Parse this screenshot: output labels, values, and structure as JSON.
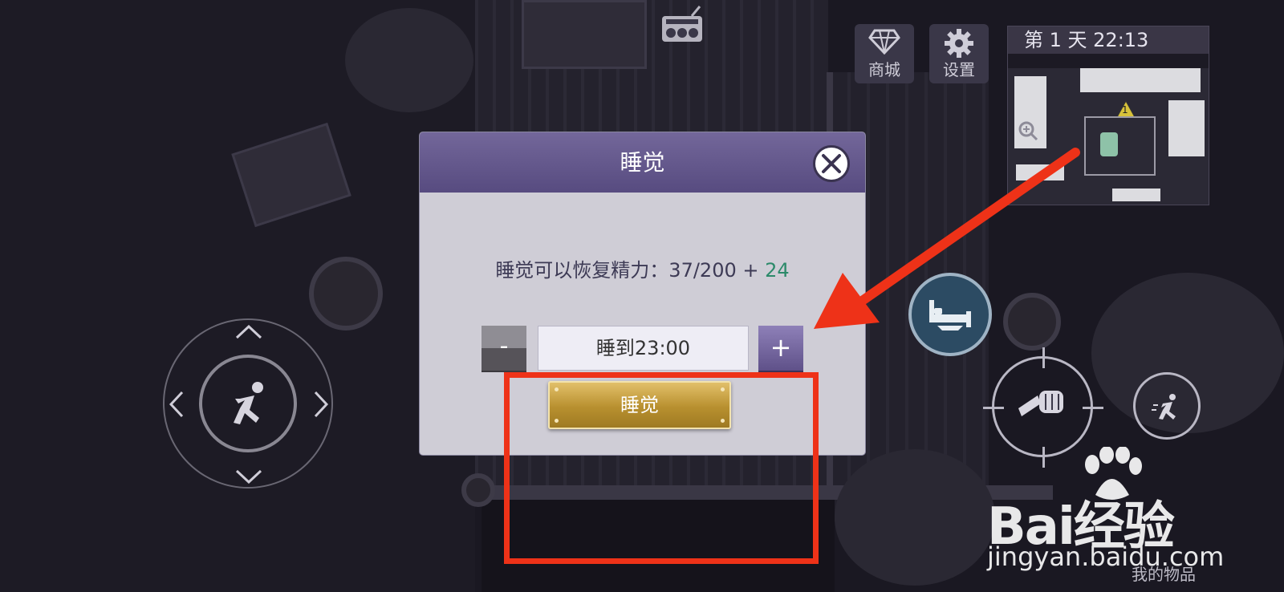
{
  "hud": {
    "shop_label": "商城",
    "settings_label": "设置",
    "inventory_label": "我的物品"
  },
  "minimap": {
    "day_time": "第 1 天  22:13",
    "marker_number": "1"
  },
  "dialog": {
    "title": "睡觉",
    "energy_prefix": "睡觉可以恢复精力：37/200 + ",
    "energy_bonus": "24",
    "minus_label": "-",
    "sleep_until": "睡到23:00",
    "plus_label": "+",
    "confirm_label": "睡觉"
  },
  "watermark": {
    "logo": "Bai经验",
    "url": "jingyan.baidu.com"
  },
  "colors": {
    "dialog_header": "#574b80",
    "bonus_green": "#2c8a6a",
    "gold_button": "#b8902f",
    "annotation_red": "#ee3218"
  }
}
